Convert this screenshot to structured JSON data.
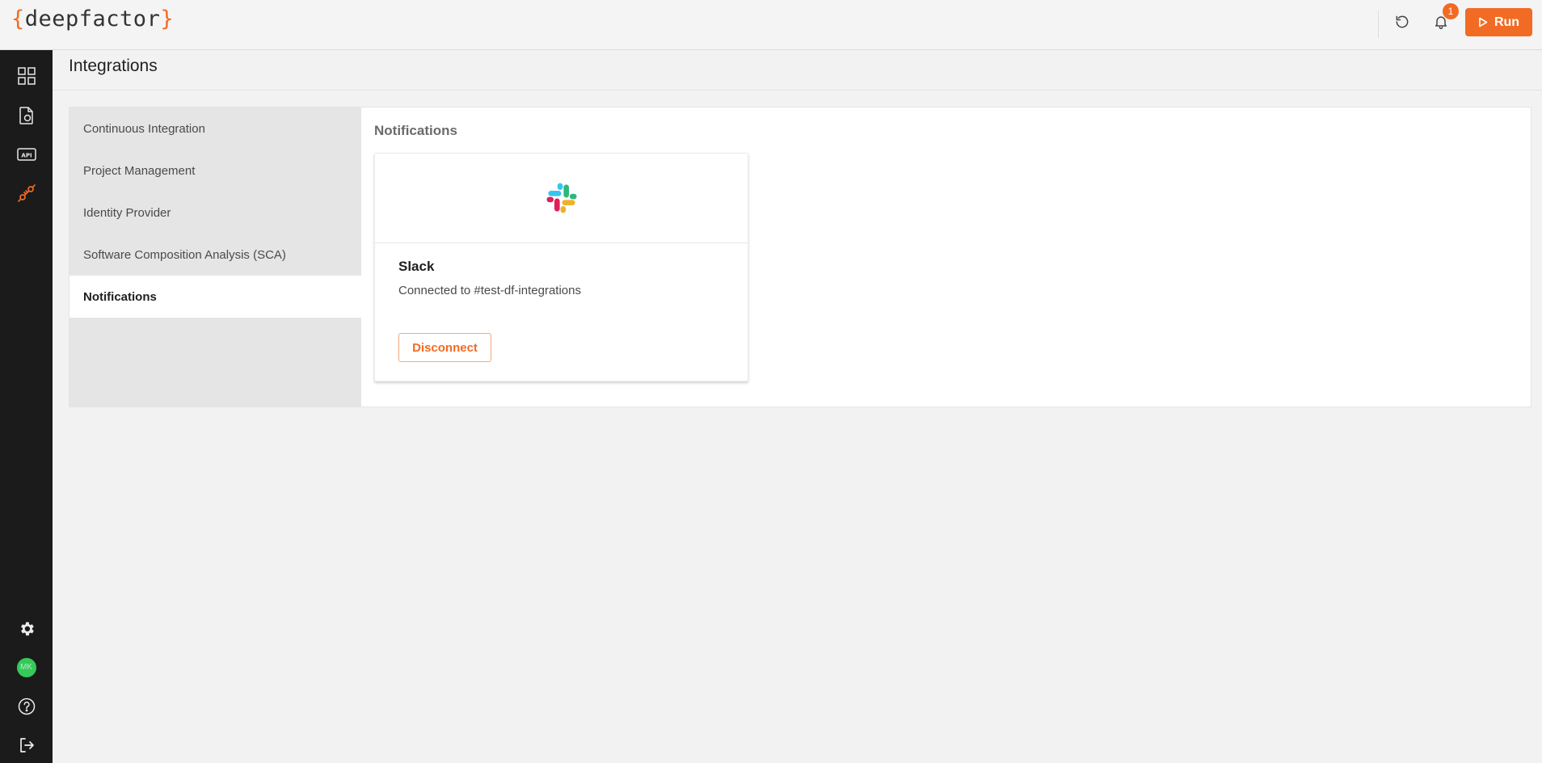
{
  "app": {
    "logo_left": "{",
    "logo_text": "deepfactor",
    "logo_right": "}",
    "brand_color": "#f26b24"
  },
  "header": {
    "notification_count": "1",
    "run_label": "Run",
    "icons": [
      "refresh-icon",
      "bell-icon",
      "play-icon"
    ]
  },
  "sidebar": {
    "top_items": [
      {
        "icon": "dashboard-grid-icon"
      },
      {
        "icon": "documents-icon"
      },
      {
        "icon": "api-icon"
      },
      {
        "icon": "integrations-plug-icon",
        "active": true
      }
    ],
    "bottom_items": [
      {
        "icon": "gear-icon"
      },
      {
        "icon": "avatar",
        "initials": "MK"
      },
      {
        "icon": "help-icon"
      },
      {
        "icon": "logout-icon"
      }
    ]
  },
  "page": {
    "title": "Integrations"
  },
  "tabs": [
    {
      "label": "Continuous Integration"
    },
    {
      "label": "Project Management"
    },
    {
      "label": "Identity Provider"
    },
    {
      "label": "Software Composition Analysis (SCA)"
    },
    {
      "label": "Notifications",
      "active": true
    }
  ],
  "content": {
    "section_title": "Notifications",
    "card": {
      "logo_icon": "slack-logo-icon",
      "name": "Slack",
      "status": "Connected to #test-df-integrations",
      "button_label": "Disconnect"
    }
  }
}
